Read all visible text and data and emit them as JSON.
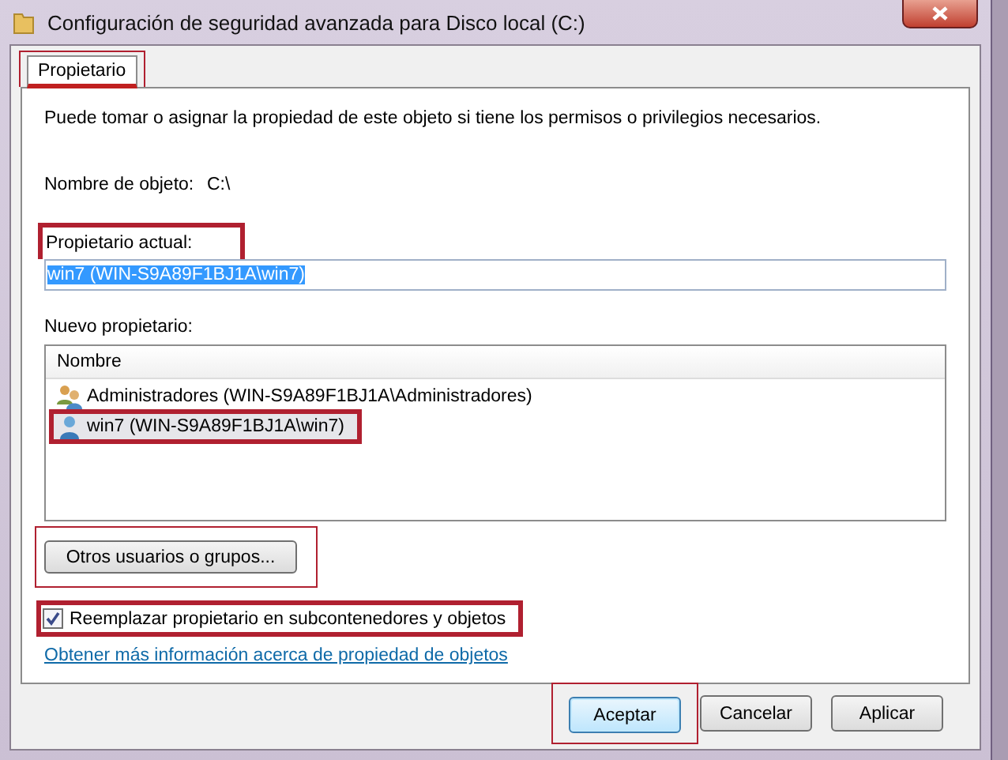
{
  "window": {
    "title": "Configuración de seguridad avanzada para Disco local (C:)"
  },
  "tabs": [
    {
      "label": "Propietario",
      "selected": true,
      "highlighted": true
    }
  ],
  "intro": "Puede tomar o asignar la propiedad de este objeto si tiene los permisos o privilegios necesarios.",
  "object_name": {
    "label": "Nombre de objeto:",
    "value": "C:\\"
  },
  "current_owner": {
    "label": "Propietario actual:",
    "value": "win7 (WIN-S9A89F1BJ1A\\win7)",
    "highlighted": true
  },
  "new_owner": {
    "label": "Nuevo propietario:",
    "column": "Nombre",
    "rows": [
      {
        "kind": "group",
        "name": "Administradores (WIN-S9A89F1BJ1A\\Administradores)",
        "selected": false,
        "highlighted": false
      },
      {
        "kind": "user",
        "name": "win7 (WIN-S9A89F1BJ1A\\win7)",
        "selected": true,
        "highlighted": true
      }
    ]
  },
  "other_users_button": {
    "label": "Otros usuarios o grupos...",
    "highlighted": true
  },
  "replace_checkbox": {
    "label": "Reemplazar propietario en subcontenedores y objetos",
    "checked": true,
    "highlighted": true
  },
  "help_link": "Obtener más información acerca de propiedad de objetos",
  "buttons": [
    {
      "label": "Aceptar",
      "default": true,
      "highlighted": true
    },
    {
      "label": "Cancelar",
      "default": false,
      "highlighted": false
    },
    {
      "label": "Aplicar",
      "default": false,
      "highlighted": false
    }
  ]
}
